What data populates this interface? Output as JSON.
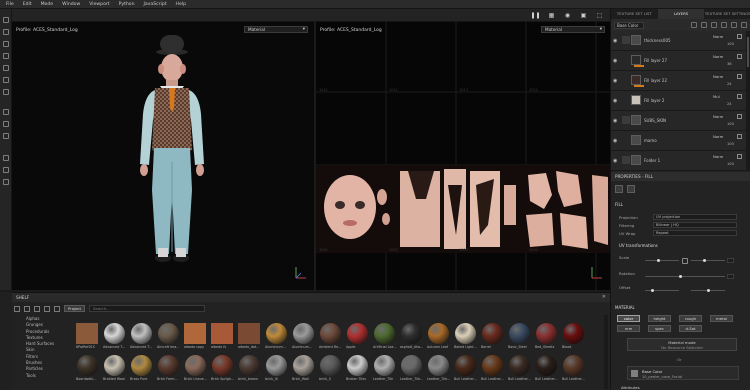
{
  "menu": [
    "File",
    "Edit",
    "Mode",
    "Window",
    "Viewport",
    "Python",
    "JavaScript",
    "Help"
  ],
  "viewport3d": {
    "profile": "Profile: ACES_Standard_Log",
    "display": "Material"
  },
  "viewport2d": {
    "profile": "Profile: ACES_Standard_Log",
    "display": "Material"
  },
  "right_tabs": [
    "TEXTURE SET LIST",
    "LAYERS",
    "TEXTURE SET SETTINGS"
  ],
  "layer_channel": "Base Color",
  "layers": [
    {
      "name": "thickness005",
      "blend": "Norm",
      "opacity": "100"
    },
    {
      "name": "Fill layer 27",
      "blend": "Norm",
      "opacity": "36"
    },
    {
      "name": "Fill layer 22",
      "blend": "Norm",
      "opacity": "24"
    },
    {
      "name": "Fill layer 2",
      "blend": "Mul",
      "opacity": "24"
    },
    {
      "name": "SUBS_SKIN",
      "blend": "Norm",
      "opacity": "100"
    },
    {
      "name": "mamo",
      "blend": "Norm",
      "opacity": "100"
    },
    {
      "name": "Folder 1",
      "blend": "Norm",
      "opacity": "100"
    }
  ],
  "properties": {
    "title": "PROPERTIES - FILL",
    "fill_section": "FILL",
    "projection_label": "Projection",
    "projection": "UV projection",
    "filtering_label": "Filtering",
    "filtering": "Bilinear | HQ",
    "uvwrap_label": "UV Wrap",
    "uvwrap": "Repeat",
    "uvtransform": "UV transformations",
    "scale": "Scale",
    "rotation": "Rotation",
    "offset": "Offset",
    "material_section": "MATERIAL",
    "channels_row1": [
      "color",
      "height",
      "rough",
      "metal"
    ],
    "channels_row2": [
      "nrm",
      "spec",
      "d-Sat"
    ],
    "material_mode": "Material mode",
    "no_resource": "No Resource Selected",
    "or": "Or",
    "base_color": "Base Color",
    "base_color_src": "10_peeler_nose_Facial",
    "attributes": "Attributes"
  },
  "shelf": {
    "title": "SHELF",
    "chip": "Project",
    "search_placeholder": "Search...",
    "categories": [
      "Alphas",
      "Grunges",
      "Procedurals",
      "Textures",
      "Hard Surfaces",
      "Skin",
      "Filters",
      "Brushes",
      "Particles",
      "Tools"
    ],
    "row1": [
      "8PatRef01S",
      "Advanced T...",
      "Advanced T...",
      "Aircraft Ima...",
      "albedo copy",
      "albedo fs",
      "albedo_dot...",
      "Aluminium...",
      "Aluminum...",
      "Ambient Re...",
      "Apple",
      "Artificial Lea...",
      "asphalt_dha...",
      "Autumn Leaf",
      "Baked Light...",
      "Barrel",
      "Basic_Steel",
      "Bed_Sheets",
      "Blood"
    ],
    "row2": [
      "Boardwalk...",
      "Braided Wool",
      "Brass Pure",
      "Brick Farm...",
      "Brick Uneve...",
      "Brick Sprigh...",
      "brick_brown",
      "brick_III",
      "Brick_Wall",
      "brick_II",
      "Broken Tiles",
      "Leather_Tile",
      "Leather_Tile...",
      "Leather_Tile...",
      "Bull Leather...",
      "Bull Leather...",
      "Bull Leather...",
      "Bull Leather...",
      "Bull Leather..."
    ],
    "row1_colors": [
      {
        "type": "sq",
        "c": "#8a5a3a"
      },
      {
        "type": "ball",
        "c": "#d8d8d8"
      },
      {
        "type": "ball",
        "c": "#c0c0c0"
      },
      {
        "type": "ball",
        "c": "#6a5a4a"
      },
      {
        "type": "sq",
        "c": "#b0683a"
      },
      {
        "type": "sq",
        "c": "#a85a38"
      },
      {
        "type": "sq",
        "c": "#7a4a32"
      },
      {
        "type": "ball",
        "c": "#c08a3a"
      },
      {
        "type": "ball",
        "c": "#9a9a9a"
      },
      {
        "type": "ball",
        "c": "#6e4a3a"
      },
      {
        "type": "ball",
        "c": "#b03030"
      },
      {
        "type": "ball",
        "c": "#4e6a30"
      },
      {
        "type": "ball",
        "c": "#2e2e2e"
      },
      {
        "type": "ball",
        "c": "#a86a28"
      },
      {
        "type": "ball",
        "c": "#dcd0b8"
      },
      {
        "type": "ball",
        "c": "#6a2a1e"
      },
      {
        "type": "ball",
        "c": "#3a4a62"
      },
      {
        "type": "ball",
        "c": "#8a3030"
      },
      {
        "type": "ball",
        "c": "#6a0e0e"
      }
    ],
    "row2_colors": [
      {
        "type": "ball",
        "c": "#3e3428"
      },
      {
        "type": "ball",
        "c": "#c8c0b0"
      },
      {
        "type": "ball",
        "c": "#b08a40"
      },
      {
        "type": "ball",
        "c": "#5a3a2e"
      },
      {
        "type": "ball",
        "c": "#8a6a5a"
      },
      {
        "type": "ball",
        "c": "#7a3a2a"
      },
      {
        "type": "ball",
        "c": "#4a3a32"
      },
      {
        "type": "ball",
        "c": "#9a9a9a"
      },
      {
        "type": "ball",
        "c": "#aaa29a"
      },
      {
        "type": "ball",
        "c": "#5a5a5a"
      },
      {
        "type": "ball",
        "c": "#cccccc"
      },
      {
        "type": "ball",
        "c": "#b0b0b0"
      },
      {
        "type": "ball",
        "c": "#6a6a6a"
      },
      {
        "type": "ball",
        "c": "#8a8a8a"
      },
      {
        "type": "ball",
        "c": "#4a2a1a"
      },
      {
        "type": "ball",
        "c": "#6a3a1a"
      },
      {
        "type": "ball",
        "c": "#3a2a22"
      },
      {
        "type": "ball",
        "c": "#2a1e18"
      },
      {
        "type": "ball",
        "c": "#5a3a28"
      }
    ]
  },
  "colors": {
    "accent_orange": "#d67a19",
    "uv_border_red": "#7a2020",
    "panel": "#232323"
  }
}
